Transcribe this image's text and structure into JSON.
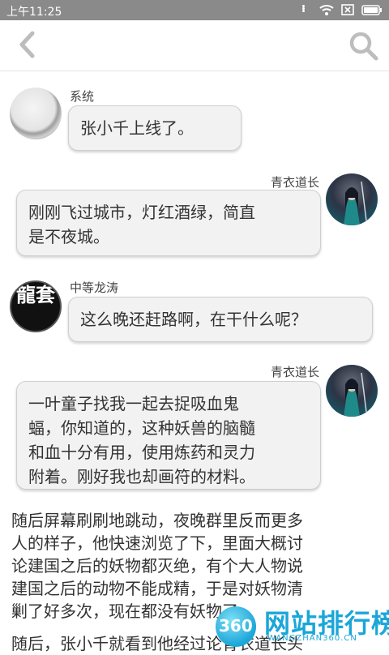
{
  "status_bar": {
    "time": "上午11:25",
    "icons": [
      "more-dots-icon",
      "wifi-icon",
      "no-sim-icon",
      "battery-icon"
    ]
  },
  "top_bar": {
    "icons": [
      "back-arrow-icon",
      "search-icon"
    ]
  },
  "messages": [
    {
      "side": "left",
      "sender": "系统",
      "avatar": "mirror-avatar",
      "text": "张小千上线了。"
    },
    {
      "side": "right",
      "sender": "青衣道长",
      "avatar": "swordsman-avatar",
      "lines": [
        "刚刚飞过城市，灯红酒绿，简直",
        "是不夜城。"
      ]
    },
    {
      "side": "left",
      "sender": "中等龙涛",
      "avatar": "dragon-calligraphy-avatar",
      "avatar_text": "龍套",
      "text": "这么晚还赶路啊，在干什么呢？"
    },
    {
      "side": "right",
      "sender": "青衣道长",
      "avatar": "swordsman-avatar",
      "lines": [
        "一叶童子找我一起去捉吸血鬼",
        "蝠，你知道的，这种妖兽的脑髓",
        "和血十分有用，使用炼药和灵力",
        "附着。刚好我也却画符的材料。"
      ]
    }
  ],
  "narrative": [
    "随后屏幕刷刷地跳动，夜晚群里反而更多",
    "人的样子，他快速浏览了下，里面大概讨",
    "论建国之后的妖物都灭绝，有个大人物说",
    "建国之后的动物不能成精，于是对妖物清",
    "剿了好多次，现在都没有妖物了。",
    "随后，张小千就看到他经过论青衣道长头"
  ],
  "watermark": {
    "logo_number": "360",
    "title": "网站排行榜",
    "url": "WANGZHAN360.CN"
  },
  "colors": {
    "status_bar": "#8a8a8a",
    "bubble_bg": "#f2f2f2",
    "bubble_border": "#cfcfcf",
    "icon_gray": "#bdbdbd",
    "watermark_blue": "#1aa6d8"
  }
}
